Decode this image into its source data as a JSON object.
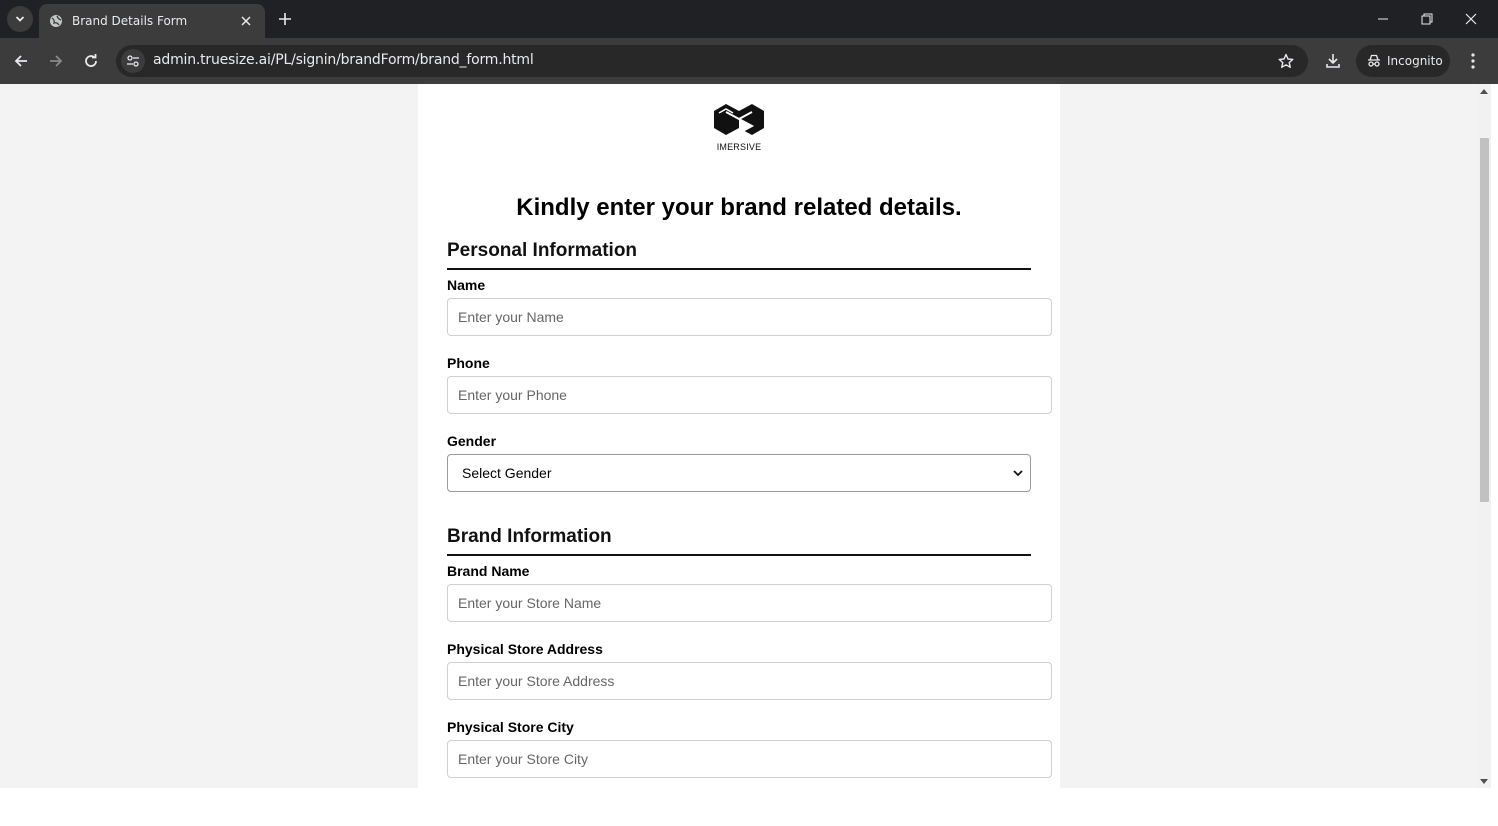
{
  "browser": {
    "tab_title": "Brand Details Form",
    "url": "admin.truesize.ai/PL/signin/brandForm/brand_form.html",
    "incognito_label": "Incognito",
    "icons": [
      "chevron-down-icon",
      "globe-icon",
      "close-icon",
      "plus-icon",
      "minimize-icon",
      "restore-icon",
      "back-arrow-icon",
      "forward-arrow-icon",
      "reload-icon",
      "site-settings-icon",
      "star-icon",
      "download-icon",
      "incognito-icon",
      "more-vert-icon"
    ]
  },
  "page": {
    "logo_text": "IMERSIVE",
    "heading": "Kindly enter your brand related details.",
    "personal_section": "Personal Information",
    "brand_section": "Brand Information",
    "fields": {
      "name": {
        "label": "Name",
        "placeholder": "Enter your Name"
      },
      "phone": {
        "label": "Phone",
        "placeholder": "Enter your Phone"
      },
      "gender": {
        "label": "Gender",
        "selected": "Select Gender"
      },
      "brand_name": {
        "label": "Brand Name",
        "placeholder": "Enter your Store Name"
      },
      "store_address": {
        "label": "Physical Store Address",
        "placeholder": "Enter your Store Address"
      },
      "store_city": {
        "label": "Physical Store City",
        "placeholder": "Enter your Store City"
      }
    }
  },
  "colors": {
    "chrome_dark": "#202124",
    "chrome_toolbar": "#3c3c3c",
    "page_background": "#f3f3f3",
    "card_background": "#ffffff"
  }
}
